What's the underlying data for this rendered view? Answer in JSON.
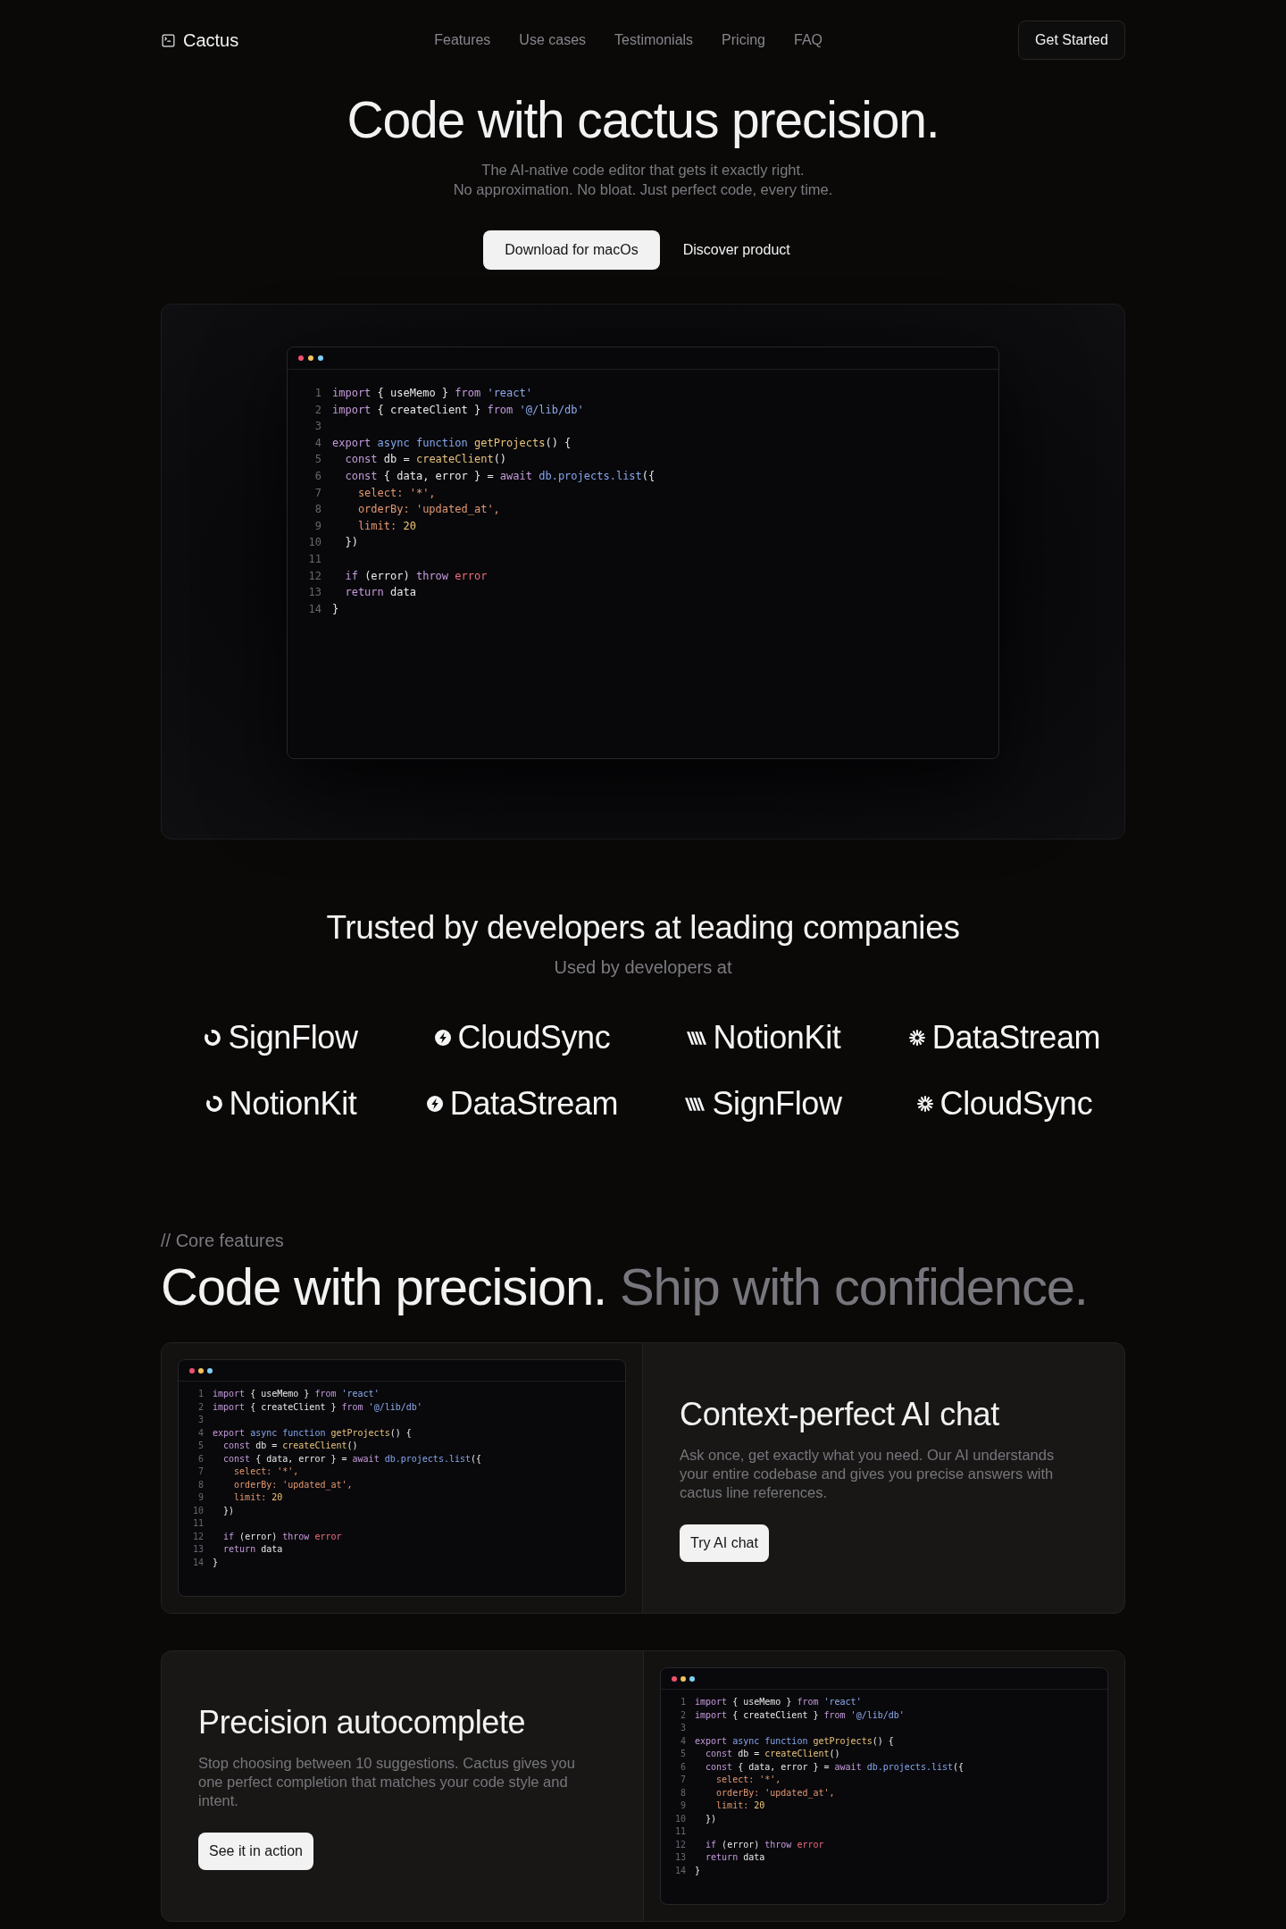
{
  "nav": {
    "logo": "Cactus",
    "links": [
      "Features",
      "Use cases",
      "Testimonials",
      "Pricing",
      "FAQ"
    ],
    "cta": "Get Started"
  },
  "hero": {
    "title": "Code with cactus precision.",
    "subtitle": [
      "The AI-native code editor that gets it exactly right.",
      "No approximation. No bloat. Just perfect code, every time."
    ],
    "buttons": [
      {
        "label": "Download for macOs",
        "kind": "primary"
      },
      {
        "label": "Discover product",
        "kind": "plain"
      }
    ],
    "code_window": {
      "dots": [
        {
          "color": "#f0506e"
        },
        {
          "color": "#f4c15d"
        },
        {
          "color": "#7fd0f7"
        }
      ],
      "lines": [
        {
          "number": "1",
          "tokens": [
            {
              "text": "import",
              "kind": "keyword"
            },
            {
              "text": " { useMemo } ",
              "kind": "plain"
            },
            {
              "text": "from",
              "kind": "keyword"
            },
            {
              "text": " 'react'",
              "kind": "string"
            }
          ]
        },
        {
          "number": "2",
          "tokens": [
            {
              "text": "import",
              "kind": "keyword"
            },
            {
              "text": " { createClient } ",
              "kind": "plain"
            },
            {
              "text": "from",
              "kind": "keyword"
            },
            {
              "text": " '@/lib/db'",
              "kind": "string"
            }
          ]
        },
        {
          "number": "3"
        },
        {
          "number": "4",
          "tokens": [
            {
              "text": "export",
              "kind": "keyword"
            },
            {
              "text": " async function",
              "kind": "storage"
            },
            {
              "text": " getProjects",
              "kind": "function"
            },
            {
              "text": "() {",
              "kind": "plain"
            }
          ]
        },
        {
          "number": "5",
          "tokens": [
            {
              "text": "  const",
              "kind": "keyword"
            },
            {
              "text": " db = ",
              "kind": "plain"
            },
            {
              "text": "createClient",
              "kind": "function"
            },
            {
              "text": "()",
              "kind": "plain"
            }
          ]
        },
        {
          "number": "6",
          "tokens": [
            {
              "text": "  const",
              "kind": "keyword"
            },
            {
              "text": " { data, error } = ",
              "kind": "plain"
            },
            {
              "text": "await",
              "kind": "keyword"
            },
            {
              "text": " db.projects.list",
              "kind": "storage"
            },
            {
              "text": "({",
              "kind": "plain"
            }
          ]
        },
        {
          "number": "7",
          "tokens": [
            {
              "text": "    select: '*',",
              "kind": "property"
            }
          ]
        },
        {
          "number": "8",
          "tokens": [
            {
              "text": "    orderBy: 'updated_at',",
              "kind": "property"
            }
          ]
        },
        {
          "number": "9",
          "tokens": [
            {
              "text": "    limit:",
              "kind": "property"
            },
            {
              "text": " 20",
              "kind": "number"
            }
          ]
        },
        {
          "number": "10",
          "tokens": [
            {
              "text": "  })",
              "kind": "plain"
            }
          ]
        },
        {
          "number": "11"
        },
        {
          "number": "12",
          "tokens": [
            {
              "text": "  if",
              "kind": "keyword"
            },
            {
              "text": " (error) ",
              "kind": "plain"
            },
            {
              "text": "throw",
              "kind": "keyword"
            },
            {
              "text": " error",
              "kind": "error"
            }
          ]
        },
        {
          "number": "13",
          "tokens": [
            {
              "text": "  return",
              "kind": "keyword"
            },
            {
              "text": " data",
              "kind": "plain"
            }
          ]
        },
        {
          "number": "14",
          "tokens": [
            {
              "text": "}",
              "kind": "plain"
            }
          ]
        }
      ]
    }
  },
  "trusted": {
    "title": "Trusted by developers at leading companies",
    "subtitle": "Used by developers at",
    "logos": [
      {
        "name": "SignFlow",
        "kind": "ring"
      },
      {
        "name": "CloudSync",
        "kind": "bolt"
      },
      {
        "name": "NotionKit",
        "kind": "stripes"
      },
      {
        "name": "DataStream",
        "kind": "sunburst"
      },
      {
        "name": "NotionKit",
        "kind": "ring"
      },
      {
        "name": "DataStream",
        "kind": "bolt"
      },
      {
        "name": "SignFlow",
        "kind": "stripes"
      },
      {
        "name": "CloudSync",
        "kind": "sunburst"
      }
    ]
  },
  "features": {
    "eyebrow": "// Core features",
    "title": "Code with precision.",
    "title_muted": "Ship with confidence.",
    "cards": [
      {
        "title": "Context-perfect AI chat",
        "description": "Ask once, get exactly what you need. Our AI understands your entire codebase and gives you precise answers with cactus line references.",
        "button": "Try AI chat",
        "kind": "code_left",
        "code_window": {
          "dots": [
            {
              "color": "#f0506e"
            },
            {
              "color": "#f4c15d"
            },
            {
              "color": "#7fd0f7"
            }
          ],
          "lines": [
            {
              "number": "1",
              "tokens": [
                {
                  "text": "import",
                  "kind": "keyword"
                },
                {
                  "text": " { useMemo } ",
                  "kind": "plain"
                },
                {
                  "text": "from",
                  "kind": "keyword"
                },
                {
                  "text": " 'react'",
                  "kind": "string"
                }
              ]
            },
            {
              "number": "2",
              "tokens": [
                {
                  "text": "import",
                  "kind": "keyword"
                },
                {
                  "text": " { createClient } ",
                  "kind": "plain"
                },
                {
                  "text": "from",
                  "kind": "keyword"
                },
                {
                  "text": " '@/lib/db'",
                  "kind": "string"
                }
              ]
            },
            {
              "number": "3"
            },
            {
              "number": "4",
              "tokens": [
                {
                  "text": "export",
                  "kind": "keyword"
                },
                {
                  "text": " async function",
                  "kind": "storage"
                },
                {
                  "text": " getProjects",
                  "kind": "function"
                },
                {
                  "text": "() {",
                  "kind": "plain"
                }
              ]
            },
            {
              "number": "5",
              "tokens": [
                {
                  "text": "  const",
                  "kind": "keyword"
                },
                {
                  "text": " db = ",
                  "kind": "plain"
                },
                {
                  "text": "createClient",
                  "kind": "function"
                },
                {
                  "text": "()",
                  "kind": "plain"
                }
              ]
            },
            {
              "number": "6",
              "tokens": [
                {
                  "text": "  const",
                  "kind": "keyword"
                },
                {
                  "text": " { data, error } = ",
                  "kind": "plain"
                },
                {
                  "text": "await",
                  "kind": "keyword"
                },
                {
                  "text": " db.projects.list",
                  "kind": "storage"
                },
                {
                  "text": "({",
                  "kind": "plain"
                }
              ]
            },
            {
              "number": "7",
              "tokens": [
                {
                  "text": "    select: '*',",
                  "kind": "property"
                }
              ]
            },
            {
              "number": "8",
              "tokens": [
                {
                  "text": "    orderBy: 'updated_at',",
                  "kind": "property"
                }
              ]
            },
            {
              "number": "9",
              "tokens": [
                {
                  "text": "    limit:",
                  "kind": "property"
                },
                {
                  "text": " 20",
                  "kind": "number"
                }
              ]
            },
            {
              "number": "10",
              "tokens": [
                {
                  "text": "  })",
                  "kind": "plain"
                }
              ]
            },
            {
              "number": "11"
            },
            {
              "number": "12",
              "tokens": [
                {
                  "text": "  if",
                  "kind": "keyword"
                },
                {
                  "text": " (error) ",
                  "kind": "plain"
                },
                {
                  "text": "throw",
                  "kind": "keyword"
                },
                {
                  "text": " error",
                  "kind": "error"
                }
              ]
            },
            {
              "number": "13",
              "tokens": [
                {
                  "text": "  return",
                  "kind": "keyword"
                },
                {
                  "text": " data",
                  "kind": "plain"
                }
              ]
            },
            {
              "number": "14",
              "tokens": [
                {
                  "text": "}",
                  "kind": "plain"
                }
              ]
            }
          ]
        }
      },
      {
        "title": "Precision autocomplete",
        "description": "Stop choosing between 10 suggestions. Cactus gives you one perfect completion that matches your code style and intent.",
        "button": "See it in action",
        "kind": "code_right",
        "code_window": {
          "dots": [
            {
              "color": "#f0506e"
            },
            {
              "color": "#f4c15d"
            },
            {
              "color": "#7fd0f7"
            }
          ],
          "lines": [
            {
              "number": "1",
              "tokens": [
                {
                  "text": "import",
                  "kind": "keyword"
                },
                {
                  "text": " { useMemo } ",
                  "kind": "plain"
                },
                {
                  "text": "from",
                  "kind": "keyword"
                },
                {
                  "text": " 'react'",
                  "kind": "string"
                }
              ]
            },
            {
              "number": "2",
              "tokens": [
                {
                  "text": "import",
                  "kind": "keyword"
                },
                {
                  "text": " { createClient } ",
                  "kind": "plain"
                },
                {
                  "text": "from",
                  "kind": "keyword"
                },
                {
                  "text": " '@/lib/db'",
                  "kind": "string"
                }
              ]
            },
            {
              "number": "3"
            },
            {
              "number": "4",
              "tokens": [
                {
                  "text": "export",
                  "kind": "keyword"
                },
                {
                  "text": " async function",
                  "kind": "storage"
                },
                {
                  "text": " getProjects",
                  "kind": "function"
                },
                {
                  "text": "() {",
                  "kind": "plain"
                }
              ]
            },
            {
              "number": "5",
              "tokens": [
                {
                  "text": "  const",
                  "kind": "keyword"
                },
                {
                  "text": " db = ",
                  "kind": "plain"
                },
                {
                  "text": "createClient",
                  "kind": "function"
                },
                {
                  "text": "()",
                  "kind": "plain"
                }
              ]
            },
            {
              "number": "6",
              "tokens": [
                {
                  "text": "  const",
                  "kind": "keyword"
                },
                {
                  "text": " { data, error } = ",
                  "kind": "plain"
                },
                {
                  "text": "await",
                  "kind": "keyword"
                },
                {
                  "text": " db.projects.list",
                  "kind": "storage"
                },
                {
                  "text": "({",
                  "kind": "plain"
                }
              ]
            },
            {
              "number": "7",
              "tokens": [
                {
                  "text": "    select: '*',",
                  "kind": "property"
                }
              ]
            },
            {
              "number": "8",
              "tokens": [
                {
                  "text": "    orderBy: 'updated_at',",
                  "kind": "property"
                }
              ]
            },
            {
              "number": "9",
              "tokens": [
                {
                  "text": "    limit:",
                  "kind": "property"
                },
                {
                  "text": " 20",
                  "kind": "number"
                }
              ]
            },
            {
              "number": "10",
              "tokens": [
                {
                  "text": "  })",
                  "kind": "plain"
                }
              ]
            },
            {
              "number": "11"
            },
            {
              "number": "12",
              "tokens": [
                {
                  "text": "  if",
                  "kind": "keyword"
                },
                {
                  "text": " (error) ",
                  "kind": "plain"
                },
                {
                  "text": "throw",
                  "kind": "keyword"
                },
                {
                  "text": " error",
                  "kind": "error"
                }
              ]
            },
            {
              "number": "13",
              "tokens": [
                {
                  "text": "  return",
                  "kind": "keyword"
                },
                {
                  "text": " data",
                  "kind": "plain"
                }
              ]
            },
            {
              "number": "14",
              "tokens": [
                {
                  "text": "}",
                  "kind": "plain"
                }
              ]
            }
          ]
        }
      }
    ]
  }
}
